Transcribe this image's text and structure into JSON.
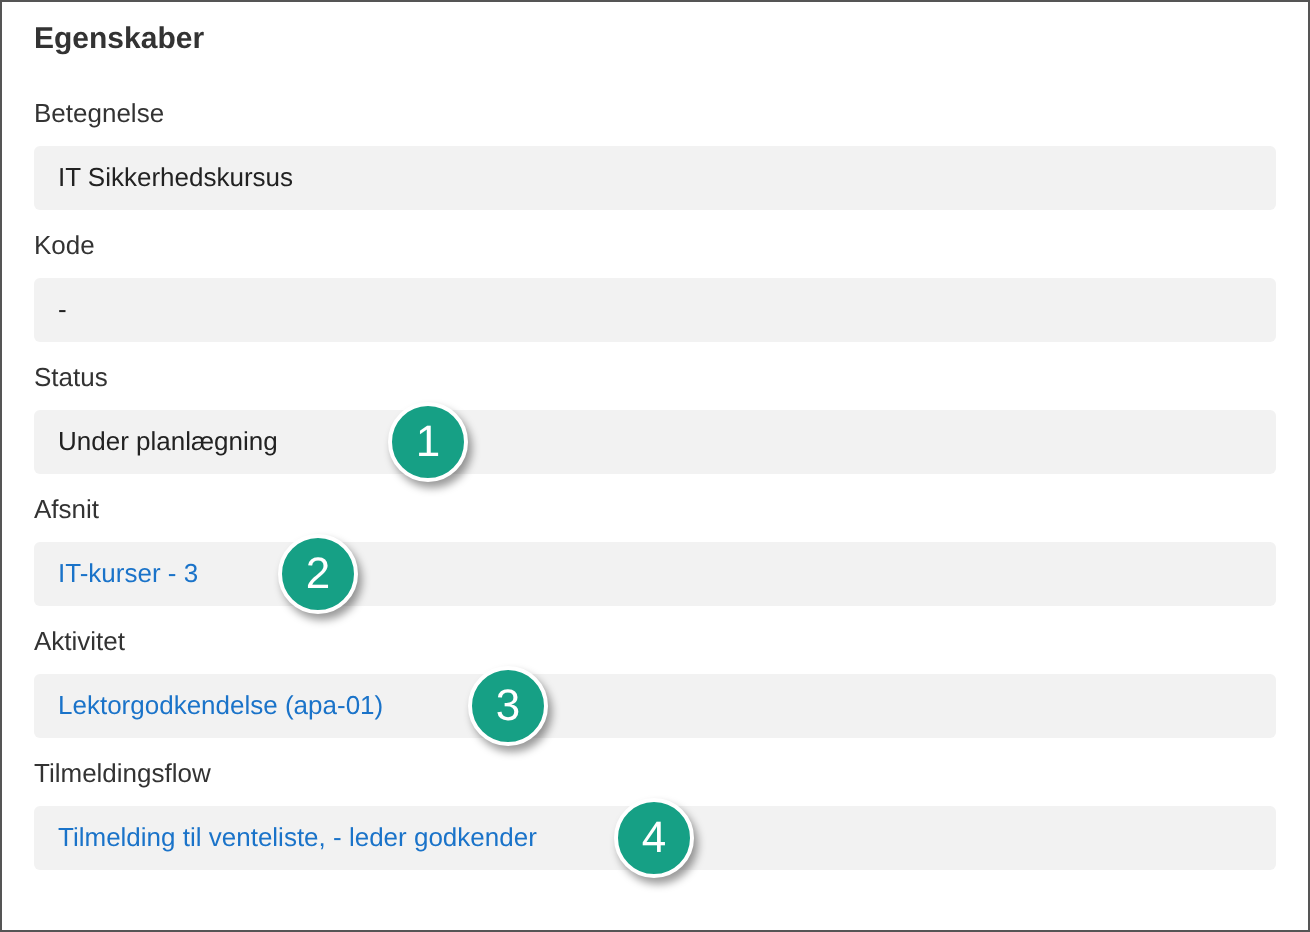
{
  "panel": {
    "title": "Egenskaber"
  },
  "fields": [
    {
      "label": "Betegnelse",
      "value": "IT Sikkerhedskursus",
      "kind": "text"
    },
    {
      "label": "Kode",
      "value": "-",
      "kind": "text"
    },
    {
      "label": "Status",
      "value": "Under planlægning",
      "kind": "text",
      "badge": "1"
    },
    {
      "label": "Afsnit",
      "value": "IT-kurser - 3",
      "kind": "link",
      "badge": "2"
    },
    {
      "label": "Aktivitet",
      "value": "Lektorgodkendelse (apa-01)",
      "kind": "link",
      "badge": "3"
    },
    {
      "label": "Tilmeldingsflow",
      "value": "Tilmelding til venteliste, - leder godkender",
      "kind": "link",
      "badge": "4"
    }
  ]
}
